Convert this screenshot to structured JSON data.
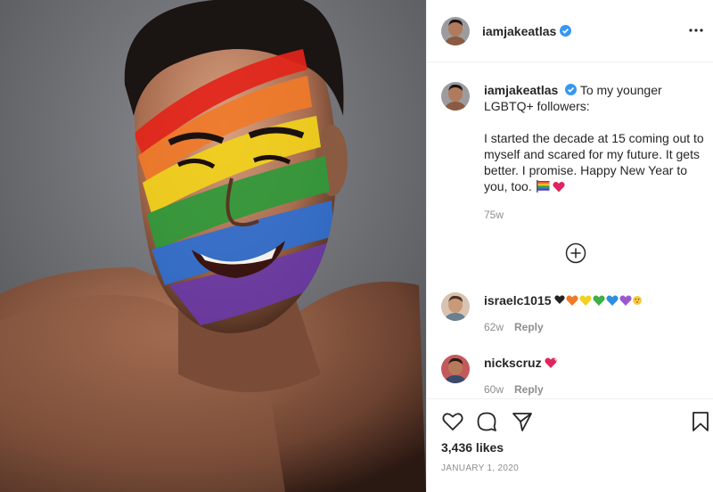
{
  "post": {
    "username": "iamjakeatlas",
    "caption_intro": "To my younger LGBTQ+ followers:",
    "caption_body": "I started the decade at 15 coming out to myself and scared for my future. It gets better. I promise. Happy New Year to you, too.",
    "caption_age": "75w",
    "likes": "3,436 likes",
    "date": "JANUARY 1, 2020"
  },
  "comments": [
    {
      "username": "israelc1015",
      "age": "62w",
      "reply_label": "Reply",
      "emoji_icons": [
        "black-heart-icon",
        "orange-heart-icon",
        "yellow-heart-icon",
        "green-heart-icon",
        "blue-heart-icon",
        "purple-heart-icon",
        "kissing-face-icon"
      ]
    },
    {
      "username": "nickscruz",
      "age": "60w",
      "reply_label": "Reply",
      "emoji_icons": [
        "sparkling-heart-icon"
      ]
    }
  ],
  "colors": {
    "verified": "#3897f0",
    "text": "#262626",
    "muted": "#8e8e8e",
    "border": "#efefef"
  },
  "icons": [
    "verified-badge-icon",
    "more-options-icon",
    "add-circle-icon",
    "heart-icon",
    "comment-icon",
    "share-icon",
    "bookmark-icon",
    "rainbow-flag-icon",
    "red-heart-icon"
  ]
}
